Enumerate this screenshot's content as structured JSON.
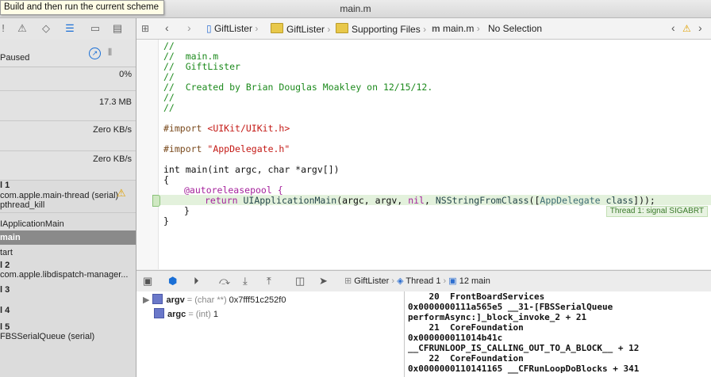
{
  "window": {
    "title": "main.m",
    "tooltip": "Build and then run the current scheme"
  },
  "left_panel": {
    "status": "Paused",
    "gauges": [
      "0%",
      "17.3 MB",
      "Zero KB/s",
      "Zero KB/s"
    ],
    "threads": [
      {
        "label": "l 1",
        "sub": "com.apple.main-thread (serial)"
      },
      {
        "label": "l 2",
        "sub": "com.apple.libdispatch-manager..."
      },
      {
        "label": "l 3"
      },
      {
        "label": "l 4"
      },
      {
        "label": "l 5",
        "sub": "FBSSerialQueue (serial)"
      }
    ],
    "frames": [
      "pthread_kill",
      "IApplicationMain",
      "main",
      "tart"
    ]
  },
  "jumpbar": {
    "items": [
      "GiftLister",
      "GiftLister",
      "Supporting Files",
      "main.m",
      "No Selection"
    ]
  },
  "code": {
    "header": [
      "//",
      "//  main.m",
      "//  GiftLister",
      "//",
      "//  Created by Brian Douglas Moakley on 12/15/12.",
      "//",
      "//"
    ],
    "import1_kw": "#import",
    "import1_path": "<UIKit/UIKit.h>",
    "import2_kw": "#import",
    "import2_path": "\"AppDelegate.h\"",
    "main_sig": "int main(int argc, char *argv[])",
    "open_brace": "{",
    "pool": "@autoreleasepool {",
    "ret_kw": "return",
    "ret_fn": "UIApplicationMain",
    "ret_args1": "(argc, argv, ",
    "ret_nil": "nil",
    "ret_sep": ", ",
    "ret_nsfn": "NSStringFromClass",
    "ret_open": "([",
    "ret_cls": "AppDelegate",
    "ret_space": " ",
    "ret_class_kw": "class",
    "ret_close": "]));",
    "inner_close": "}",
    "close_brace": "}",
    "error_badge": "Thread 1: signal SIGABRT"
  },
  "debug_bar": {
    "breadcrumb": [
      "GiftLister",
      "Thread 1",
      "12 main"
    ]
  },
  "variables": [
    {
      "name": "argv",
      "type": "= (char **)",
      "value": "0x7fff51c252f0"
    },
    {
      "name": "argc",
      "type": "= (int)",
      "value": "1"
    }
  ],
  "console": [
    "    20  FrontBoardServices",
    "0x0000000111a565e5 __31-[FBSSerialQueue",
    "performAsync:]_block_invoke_2 + 21",
    "    21  CoreFoundation",
    "0x000000011014b41c",
    "__CFRUNLOOP_IS_CALLING_OUT_TO_A_BLOCK__ + 12",
    "    22  CoreFoundation",
    "0x0000000110141165 __CFRunLoopDoBlocks + 341"
  ]
}
